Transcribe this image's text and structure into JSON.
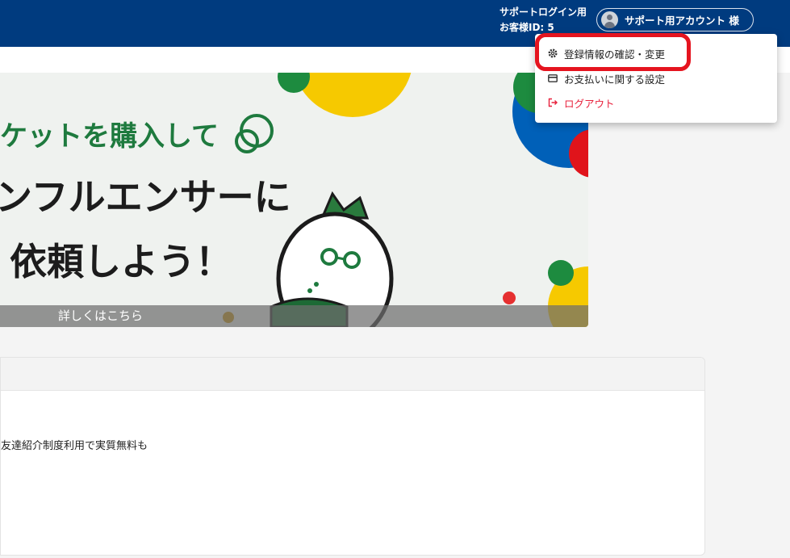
{
  "header": {
    "support_login": "サポートログイン用",
    "customer_id": "お客様ID: 5",
    "account_name": "サポート用アカウント 様"
  },
  "banner": {
    "line1": "ケットを購入して",
    "line2": "ンフルエンサーに",
    "line3": "依頼しよう！",
    "caption": "詳しくはこちら"
  },
  "card": {
    "text": "友達紹介制度利用で実質無料も"
  },
  "menu": {
    "items": [
      {
        "label": "登録情報の確認・変更",
        "icon": "gear-icon"
      },
      {
        "label": "お支払いに関する設定",
        "icon": "credit-card-icon"
      },
      {
        "label": "ログアウト",
        "icon": "logout-icon"
      }
    ]
  },
  "colors": {
    "header_bg": "#003b7f",
    "accent_green": "#1e7a3e",
    "logout_red": "#e8213c",
    "highlight_red": "#e5141f"
  }
}
